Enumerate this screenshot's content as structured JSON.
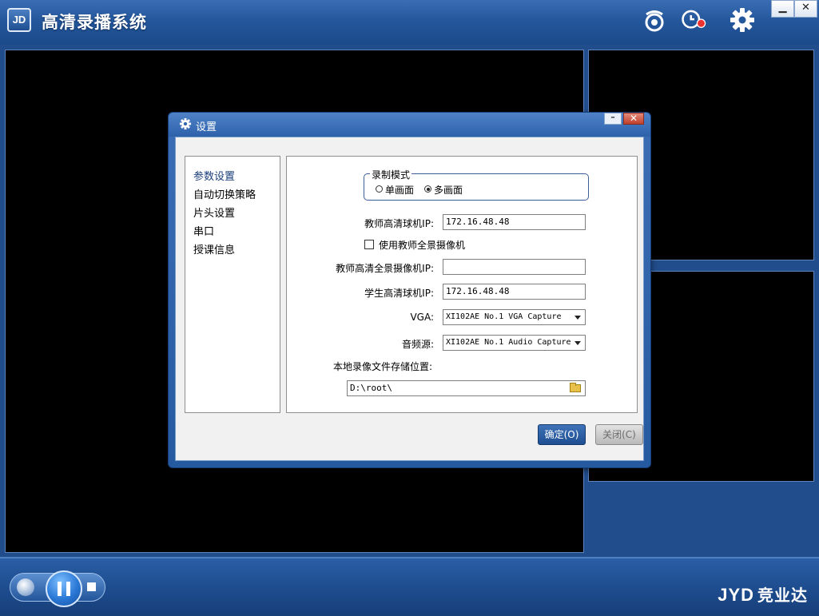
{
  "app": {
    "logo_text": "JD",
    "title": "高清录播系统",
    "brand_logo": "JYD",
    "brand_name": "竞业达",
    "window_controls": {
      "minimize": "▁",
      "close": "✕"
    }
  },
  "toolbar_icons": [
    "record-icon",
    "record-status-icon",
    "gear-icon"
  ],
  "playback_controls": [
    "seek-icon",
    "pause-icon",
    "stop-icon"
  ],
  "dialog": {
    "title": "设置",
    "minimize": "–",
    "close": "✕",
    "nav": [
      {
        "label": "参数设置",
        "active": true
      },
      {
        "label": "自动切换策略"
      },
      {
        "label": "片头设置"
      },
      {
        "label": "串口"
      },
      {
        "label": "授课信息"
      }
    ],
    "record_mode": {
      "legend": "录制模式",
      "options": [
        {
          "label": "单画面",
          "selected": false
        },
        {
          "label": "多画面",
          "selected": true
        }
      ]
    },
    "teacher_hd_ip": {
      "label": "教师高清球机IP:",
      "value": "172.16.48.48"
    },
    "use_teacher_panorama": {
      "label": "使用教师全景摄像机",
      "checked": false
    },
    "teacher_panorama_ip": {
      "label": "教师高清全景摄像机IP:",
      "value": ""
    },
    "student_hd_ip": {
      "label": "学生高清球机IP:",
      "value": "172.16.48.48"
    },
    "vga": {
      "label": "VGA:",
      "value": "XI102AE No.1 VGA Capture"
    },
    "audio_source": {
      "label": "音频源:",
      "value": "XI102AE No.1 Audio Capture"
    },
    "storage": {
      "label": "本地录像文件存储位置:",
      "value": "D:\\root\\"
    },
    "ok_label": "确定(O)",
    "close_label": "关闭(C)"
  },
  "colors": {
    "frame_blue": "#24579c",
    "video_bg": "#000000",
    "ok_button": "#1f4f92",
    "close_button_text": "#6c6c6c"
  }
}
